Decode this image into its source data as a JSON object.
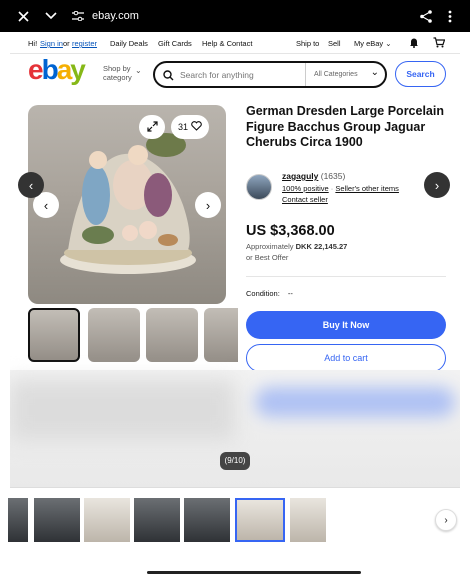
{
  "browser": {
    "url": "ebay.com"
  },
  "util": {
    "greeting": "Hi!",
    "sign_in": "Sign in",
    "or": "or",
    "register": "register",
    "daily_deals": "Daily Deals",
    "gift_cards": "Gift Cards",
    "help": "Help & Contact",
    "ship_to": "Ship to",
    "sell": "Sell",
    "my_ebay": "My eBay"
  },
  "header": {
    "logo": {
      "e": "e",
      "b": "b",
      "a": "a",
      "y": "y"
    },
    "shop_by_line1": "Shop by",
    "shop_by_line2": "category",
    "search_placeholder": "Search for anything",
    "category_select": "All Categories",
    "search_button": "Search"
  },
  "gallery": {
    "likes": "31",
    "image_counter": "(9/10)"
  },
  "listing": {
    "title": "German Dresden Large Porcelain Figure Bacchus Group Jaguar Cherubs Circa 1900",
    "seller_name": "zagaguly",
    "seller_feedback": "(1635)",
    "positive": "100% positive",
    "other_items": "Seller's other items",
    "contact": "Contact seller",
    "price": "US $3,368.00",
    "approx_label": "Approximately",
    "approx_value": "DKK 22,145.27",
    "offer": "or Best Offer",
    "condition_label": "Condition:",
    "condition_value": "--",
    "buy_now": "Buy It Now",
    "add_to_cart": "Add to cart"
  },
  "colors": {
    "accent": "#3665f3",
    "ebay_red": "#e53238",
    "ebay_blue": "#0064d2",
    "ebay_yellow": "#f5af02",
    "ebay_green": "#86b817"
  },
  "icons": [
    "close-icon",
    "chevron-down-icon",
    "tune-icon",
    "share-icon",
    "more-vert-icon",
    "bell-icon",
    "cart-icon",
    "search-icon",
    "expand-icon",
    "heart-icon",
    "chevron-left-icon",
    "chevron-right-icon"
  ]
}
